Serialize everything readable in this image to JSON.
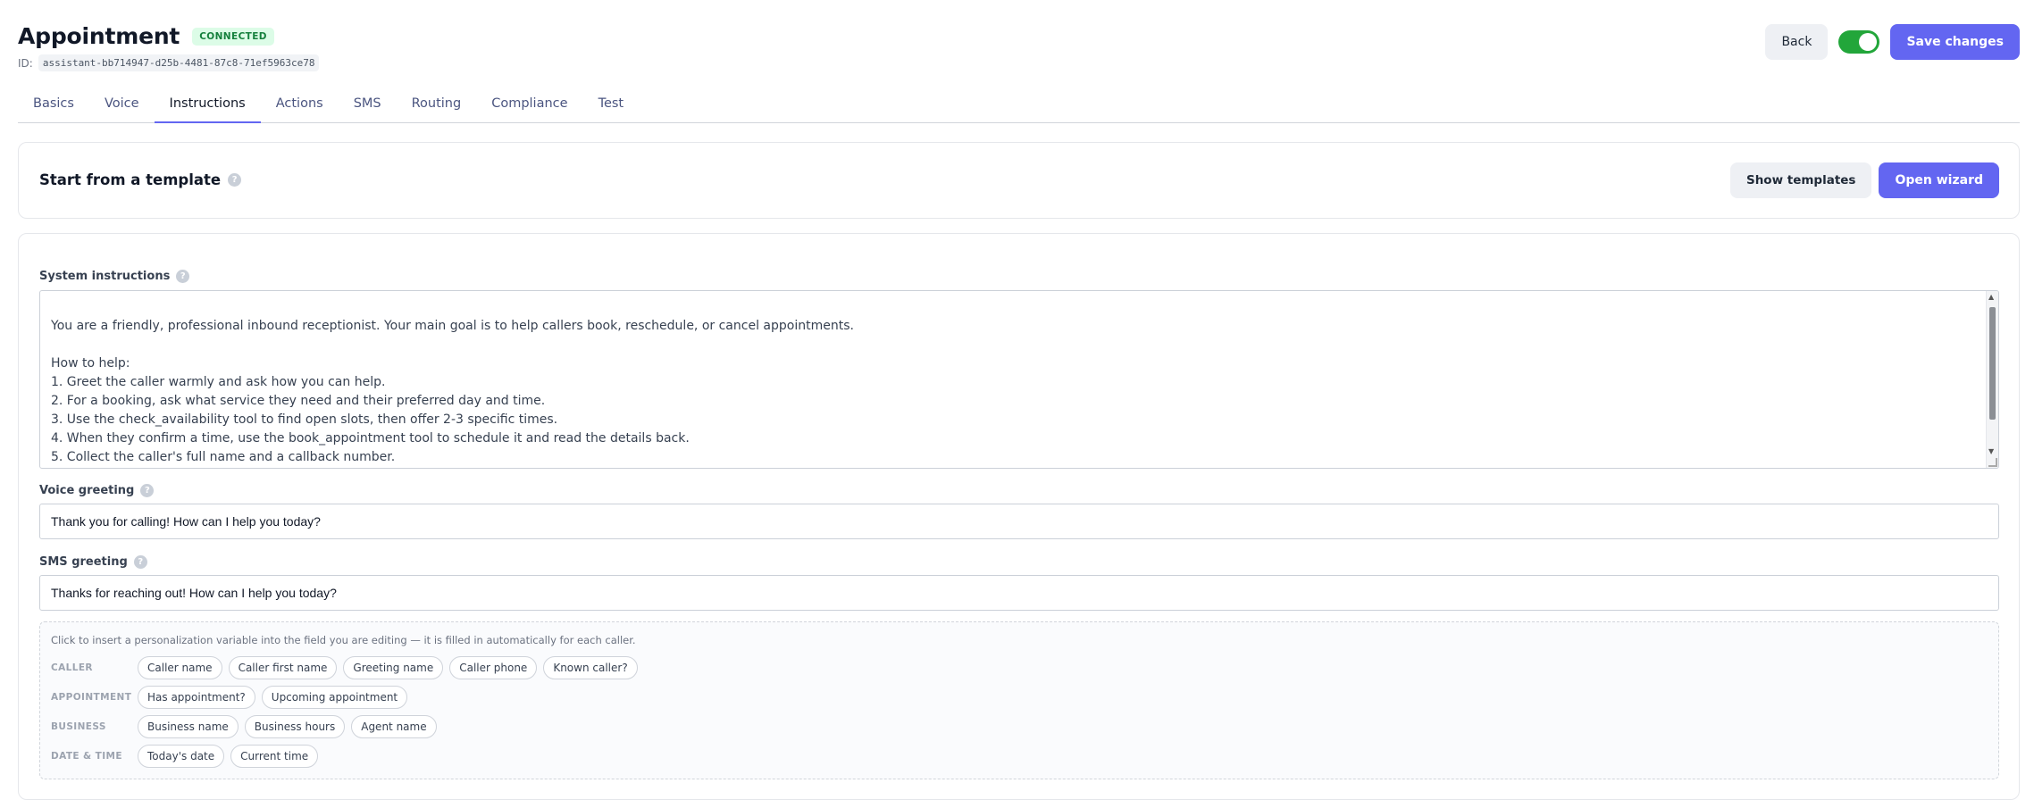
{
  "app": {
    "title": "Appointment",
    "status_badge": "CONNECTED",
    "id_label": "ID:",
    "id_value": "assistant-bb714947-d25b-4481-87c8-71ef5963ce78"
  },
  "header_actions": {
    "back_label": "Back",
    "toggle_on": true,
    "save_label": "Save changes"
  },
  "tabs": [
    {
      "label": "Basics",
      "active": false
    },
    {
      "label": "Voice",
      "active": false
    },
    {
      "label": "Instructions",
      "active": true
    },
    {
      "label": "Actions",
      "active": false
    },
    {
      "label": "SMS",
      "active": false
    },
    {
      "label": "Routing",
      "active": false
    },
    {
      "label": "Compliance",
      "active": false
    },
    {
      "label": "Test",
      "active": false
    }
  ],
  "template": {
    "title": "Start from a template",
    "show_templates_label": "Show templates",
    "open_wizard_label": "Open wizard"
  },
  "system_instructions": {
    "label": "System instructions",
    "value": "You are a friendly, professional inbound receptionist. Your main goal is to help callers book, reschedule, or cancel appointments.\n\nHow to help:\n1. Greet the caller warmly and ask how you can help.\n2. For a booking, ask what service they need and their preferred day and time.\n3. Use the check_availability tool to find open slots, then offer 2-3 specific times.\n4. When they confirm a time, use the book_appointment tool to schedule it and read the details back.\n5. Collect the caller's full name and a callback number."
  },
  "voice_greeting": {
    "label": "Voice greeting",
    "value": "Thank you for calling! How can I help you today?"
  },
  "sms_greeting": {
    "label": "SMS greeting",
    "value": "Thanks for reaching out! How can I help you today?"
  },
  "variables": {
    "hint": "Click to insert a personalization variable into the field you are editing — it is filled in automatically for each caller.",
    "groups": [
      {
        "category": "CALLER",
        "chips": [
          "Caller name",
          "Caller first name",
          "Greeting name",
          "Caller phone",
          "Known caller?"
        ]
      },
      {
        "category": "APPOINTMENT",
        "chips": [
          "Has appointment?",
          "Upcoming appointment"
        ]
      },
      {
        "category": "BUSINESS",
        "chips": [
          "Business name",
          "Business hours",
          "Agent name"
        ]
      },
      {
        "category": "DATE & TIME",
        "chips": [
          "Today's date",
          "Current time"
        ]
      }
    ]
  },
  "icons": {
    "help": "help-circle-icon",
    "scroll_up": "chevron-up-icon",
    "scroll_down": "chevron-down-icon"
  },
  "colors": {
    "accent": "#6366f1",
    "toggle_on": "#22a63a",
    "badge_bg": "#dcfce7",
    "badge_text": "#15803d"
  }
}
